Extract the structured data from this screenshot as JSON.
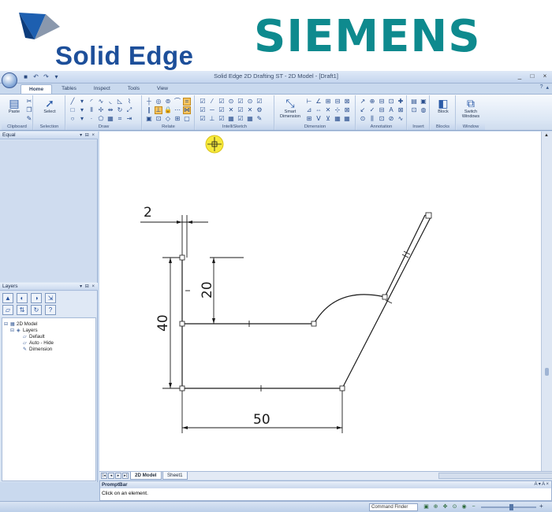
{
  "branding": {
    "solid_edge": "Solid Edge",
    "siemens": "SIEMENS"
  },
  "window": {
    "title": "Solid Edge 2D Drafting ST - 2D Model - [Draft1]",
    "controls": [
      "_",
      "□",
      "×"
    ]
  },
  "ribbon": {
    "tabs": [
      {
        "label": "Home",
        "active": true
      },
      {
        "label": "Tables",
        "active": false
      },
      {
        "label": "Inspect",
        "active": false
      },
      {
        "label": "Tools",
        "active": false
      },
      {
        "label": "View",
        "active": false
      }
    ],
    "groups": {
      "clipboard": {
        "label": "Clipboard",
        "paste": "Paste"
      },
      "selection": {
        "label": "Selection",
        "select": "Select"
      },
      "draw": {
        "label": "Draw"
      },
      "relate": {
        "label": "Relate"
      },
      "intellisketch": {
        "label": "IntelliSketch"
      },
      "dimension": {
        "label": "Dimension",
        "smart_dimension": "Smart Dimension"
      },
      "annotation": {
        "label": "Annotation"
      },
      "insert": {
        "label": "Insert"
      },
      "blocks": {
        "label": "Blocks",
        "block": "Block"
      },
      "window": {
        "label": "Window",
        "switch_windows": "Switch Windows"
      }
    }
  },
  "panels": {
    "equal": {
      "title": "Equal"
    },
    "layers": {
      "title": "Layers",
      "tree": [
        {
          "label": "2D Model",
          "level": 0
        },
        {
          "label": "Layers",
          "level": 1
        },
        {
          "label": "Default",
          "level": 2
        },
        {
          "label": "Auto - Hide",
          "level": 2
        },
        {
          "label": "Dimension",
          "level": 2
        }
      ]
    }
  },
  "drawing": {
    "dimensions": {
      "top": "2",
      "mid": "20",
      "height": "40",
      "width": "50"
    }
  },
  "sheets": {
    "tabs": [
      {
        "label": "2D Model",
        "active": true
      },
      {
        "label": "Sheet1",
        "active": false
      }
    ]
  },
  "promptbar": {
    "title": "PromptBar",
    "text": "Click on an element."
  },
  "status": {
    "command_finder": "Command Finder",
    "zoom_level": 0.55
  },
  "colors": {
    "accent": "#1d4f9a",
    "siemens": "#0e8a8e",
    "cursor": "#f7ea3a"
  }
}
